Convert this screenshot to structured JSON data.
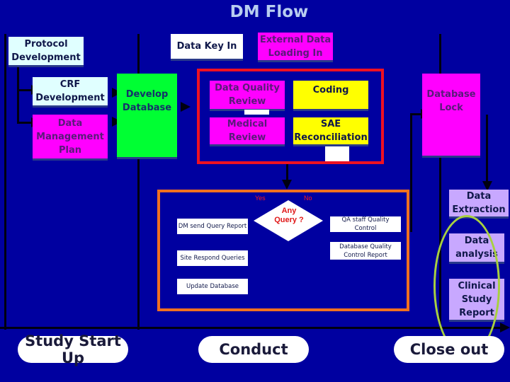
{
  "title": "DM Flow",
  "phases": {
    "start_up": "Study Start Up",
    "conduct": "Conduct",
    "close_out": "Close out"
  },
  "start_up": {
    "protocol": "Protocol Development",
    "crf": "CRF Development",
    "dmp": "Data Management Plan",
    "develop_db": "Develop Database"
  },
  "conduct": {
    "data_key_in": "Data Key In",
    "external_data": "External Data Loading In",
    "dq_review": "Data Quality Review",
    "coding": "Coding",
    "medical_review": "Medical Review",
    "sae": "SAE Reconciliation",
    "query_loop": {
      "decision": "Any Query ?",
      "yes_label": "Yes",
      "no_label": "No",
      "dm_send": "DM send Query Report",
      "site_respond": "Site Respond Queries",
      "update_db": "Update Database",
      "qa_staff": "QA staff Quality Control",
      "db_qc_report": "Database Quality Control Report"
    }
  },
  "close_out": {
    "db_lock": "Database Lock",
    "extraction": "Data Extraction",
    "analysis": "Data analysis",
    "csr": "Clinical Study Report"
  }
}
